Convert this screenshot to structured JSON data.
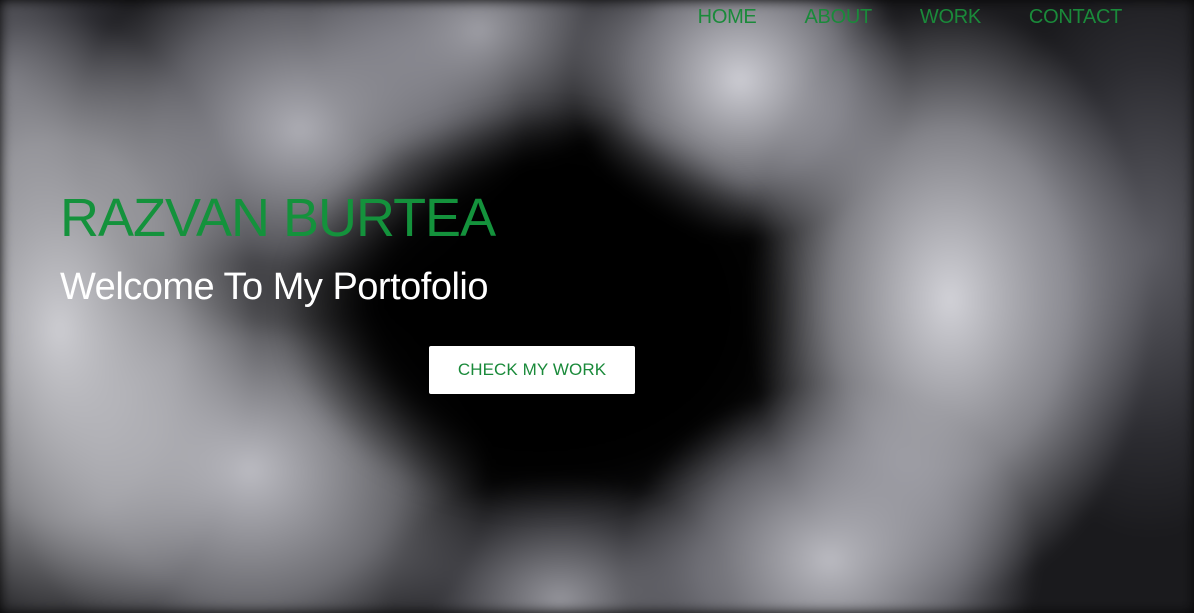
{
  "nav": {
    "items": [
      {
        "label": "HOME"
      },
      {
        "label": "ABOUT"
      },
      {
        "label": "WORK"
      },
      {
        "label": "CONTACT"
      }
    ]
  },
  "hero": {
    "title": "RAZVAN BURTEA",
    "subtitle": "Welcome To My Portofolio",
    "cta_label": "CHECK MY WORK",
    "background": "smoke-image"
  },
  "colors": {
    "accent": "#14923c",
    "nav_text": "#1a8a3a",
    "subtitle_text": "#ffffff",
    "button_bg": "#ffffff",
    "background": "#050505"
  }
}
